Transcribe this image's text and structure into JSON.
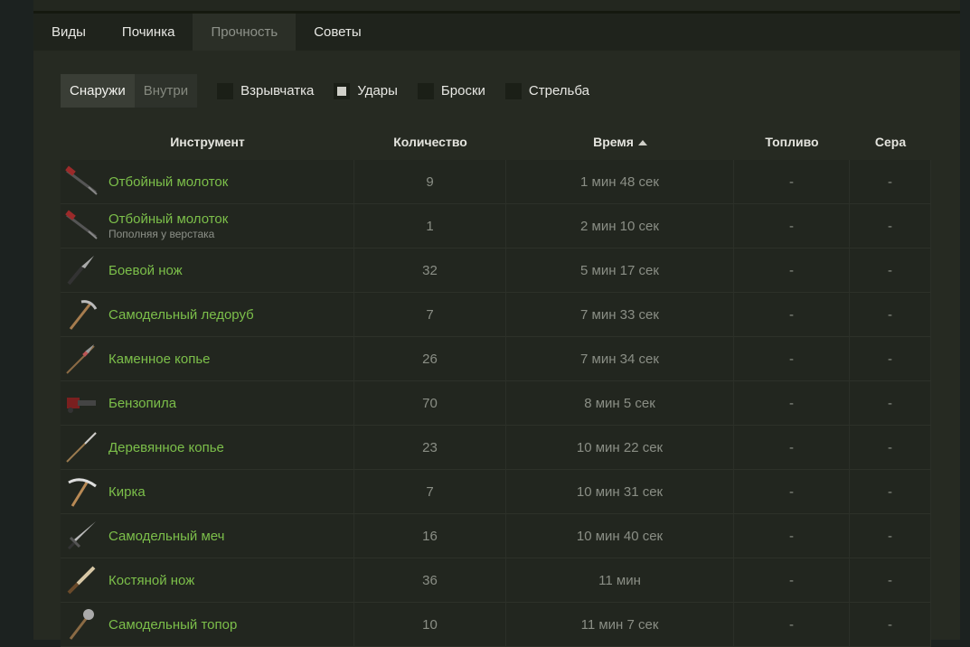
{
  "tabs": [
    {
      "label": "Виды"
    },
    {
      "label": "Починка"
    },
    {
      "label": "Прочность"
    },
    {
      "label": "Советы"
    }
  ],
  "filters": {
    "segment": [
      {
        "label": "Снаружи"
      },
      {
        "label": "Внутри"
      }
    ],
    "checks": [
      {
        "label": "Взрывчатка",
        "checked": false
      },
      {
        "label": "Удары",
        "checked": true
      },
      {
        "label": "Броски",
        "checked": false
      },
      {
        "label": "Стрельба",
        "checked": false
      }
    ]
  },
  "table": {
    "headers": {
      "tool": "Инструмент",
      "qty": "Количество",
      "time": "Время",
      "fuel": "Топливо",
      "sulfur": "Сера"
    },
    "rows": [
      {
        "name": "Отбойный молоток",
        "sub": "",
        "qty": "9",
        "time": "1 мин 48 сек",
        "fuel": "-",
        "sulfur": "-",
        "icon": "jackhammer-icon"
      },
      {
        "name": "Отбойный молоток",
        "sub": "Пополняя у верстака",
        "qty": "1",
        "time": "2 мин 10 сек",
        "fuel": "-",
        "sulfur": "-",
        "icon": "jackhammer-icon"
      },
      {
        "name": "Боевой нож",
        "sub": "",
        "qty": "32",
        "time": "5 мин 17 сек",
        "fuel": "-",
        "sulfur": "-",
        "icon": "combat-knife-icon"
      },
      {
        "name": "Самодельный ледоруб",
        "sub": "",
        "qty": "7",
        "time": "7 мин 33 сек",
        "fuel": "-",
        "sulfur": "-",
        "icon": "ice-pick-icon"
      },
      {
        "name": "Каменное копье",
        "sub": "",
        "qty": "26",
        "time": "7 мин 34 сек",
        "fuel": "-",
        "sulfur": "-",
        "icon": "stone-spear-icon"
      },
      {
        "name": "Бензопила",
        "sub": "",
        "qty": "70",
        "time": "8 мин 5 сек",
        "fuel": "-",
        "sulfur": "-",
        "icon": "chainsaw-icon"
      },
      {
        "name": "Деревянное копье",
        "sub": "",
        "qty": "23",
        "time": "10 мин 22 сек",
        "fuel": "-",
        "sulfur": "-",
        "icon": "wooden-spear-icon"
      },
      {
        "name": "Кирка",
        "sub": "",
        "qty": "7",
        "time": "10 мин 31 сек",
        "fuel": "-",
        "sulfur": "-",
        "icon": "pickaxe-icon"
      },
      {
        "name": "Самодельный меч",
        "sub": "",
        "qty": "16",
        "time": "10 мин 40 сек",
        "fuel": "-",
        "sulfur": "-",
        "icon": "sword-icon"
      },
      {
        "name": "Костяной нож",
        "sub": "",
        "qty": "36",
        "time": "11 мин",
        "fuel": "-",
        "sulfur": "-",
        "icon": "bone-knife-icon"
      },
      {
        "name": "Самодельный топор",
        "sub": "",
        "qty": "10",
        "time": "11 мин 7 сек",
        "fuel": "-",
        "sulfur": "-",
        "icon": "axe-icon"
      }
    ]
  }
}
